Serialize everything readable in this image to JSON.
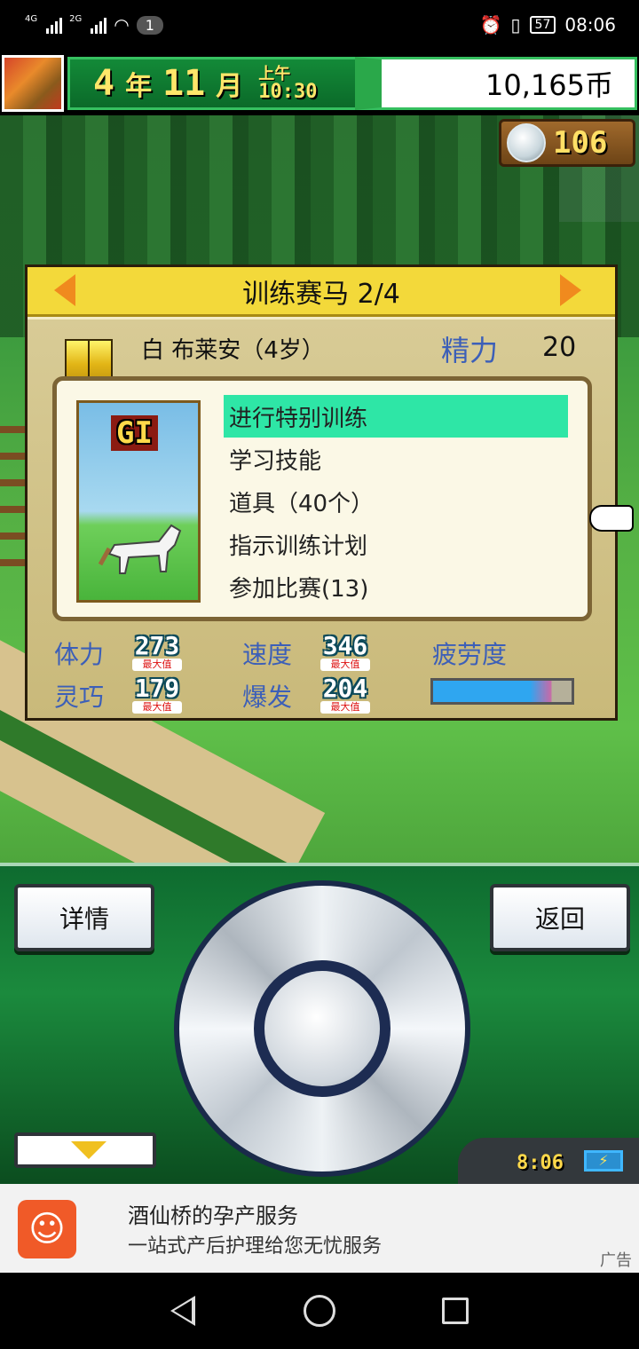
{
  "status_bar": {
    "network_1": "4G",
    "network_2": "2G",
    "notification_count": "1",
    "battery": "57",
    "time": "08:06"
  },
  "hud": {
    "year": "4",
    "year_unit": "年",
    "month": "11",
    "month_unit": "月",
    "am_pm": "上午",
    "clock": "10:30",
    "money": "10,165币",
    "token_count": "106"
  },
  "dialog": {
    "title": "训练赛马 2/4",
    "horse_name": "白 布莱安（4岁）",
    "energy_label": "精力",
    "energy_value": "20",
    "grade": "GI",
    "menu": [
      {
        "label": "进行特别训练",
        "selected": true
      },
      {
        "label": "学习技能",
        "selected": false
      },
      {
        "label": "道具（40个）",
        "selected": false
      },
      {
        "label": "指示训练计划",
        "selected": false
      },
      {
        "label": "参加比赛(13)",
        "selected": false
      }
    ],
    "stats": {
      "stamina_label": "体力",
      "stamina_value": "273",
      "speed_label": "速度",
      "speed_value": "346",
      "fatigue_label": "疲劳度",
      "agility_label": "灵巧",
      "agility_value": "179",
      "burst_label": "爆发",
      "burst_value": "204",
      "max_tag": "最大值",
      "fatigue_level": 0.7
    }
  },
  "controller": {
    "details_label": "详情",
    "back_label": "返回",
    "clock": "8:06",
    "battery_icon": "lightning-icon"
  },
  "ad": {
    "title": "酒仙桥的孕产服务",
    "subtitle": "一站式产后护理给您无忧服务",
    "tag": "广告",
    "icon_color": "#f05a28"
  },
  "colors": {
    "hud_green": "#138a38",
    "label_blue": "#3c5fb8",
    "menu_highlight": "#2ee6a6",
    "dialog_header": "#f3d93a"
  }
}
